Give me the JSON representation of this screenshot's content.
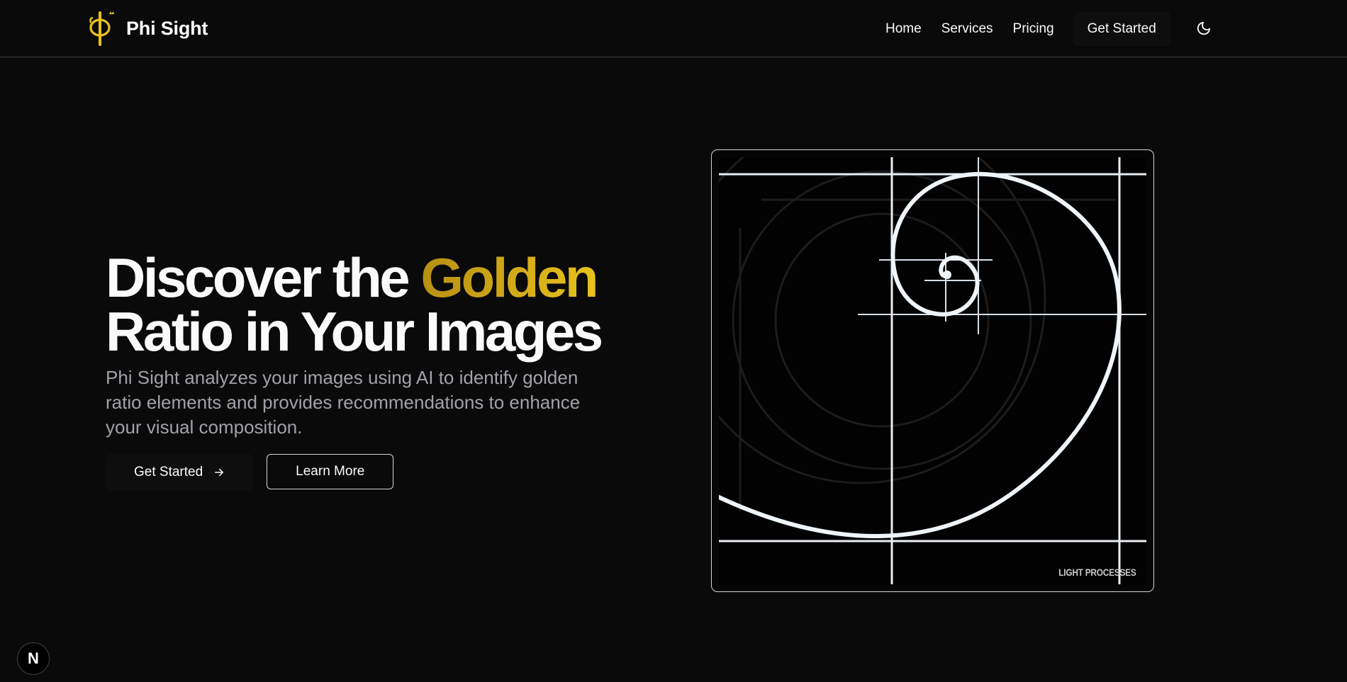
{
  "brand": {
    "name": "Phi Sight",
    "logo_icon": "phi-crown-icon",
    "accent_color": "#e9c21c"
  },
  "nav": {
    "links": [
      "Home",
      "Services",
      "Pricing"
    ],
    "cta": "Get Started",
    "theme_icon": "moon-icon"
  },
  "hero": {
    "title_line1_part1": "Discover the ",
    "title_line1_accent": "Golden",
    "title_line2": "Ratio in Your Images",
    "description": "Phi Sight analyzes your images using AI to identify golden ratio elements and provides recommendations to enhance your visual composition.",
    "primary_button": "Get Started",
    "primary_button_icon": "arrow-right-icon",
    "secondary_button": "Learn More"
  },
  "image": {
    "subject": "golden-spiral-illustration",
    "watermark": "LIGHT PROCESSES"
  },
  "dev_badge": {
    "label": "N",
    "icon": "nextjs-icon"
  }
}
